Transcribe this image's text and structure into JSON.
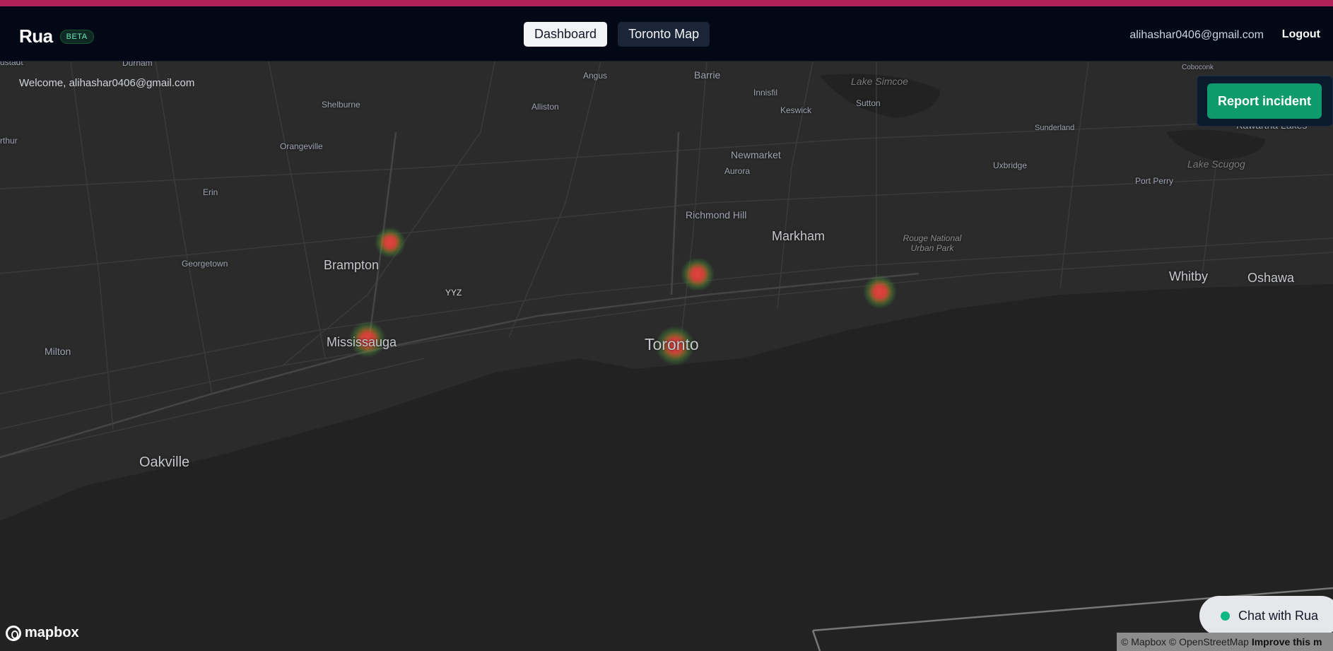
{
  "header": {
    "brand": "Rua",
    "badge": "BETA",
    "nav": [
      {
        "label": "Dashboard",
        "active": true
      },
      {
        "label": "Toronto Map",
        "active": false
      }
    ],
    "user_email": "alihashar0406@gmail.com",
    "logout_label": "Logout"
  },
  "map": {
    "welcome": "Welcome, alihashar0406@gmail.com",
    "report_button": "Report incident",
    "chat_button": "Chat with Rua",
    "logo_text": "mapbox",
    "attribution": {
      "text": "© Mapbox © OpenStreetMap",
      "link": "Improve this m"
    },
    "places": {
      "durham": "Durham",
      "ustadt": "ustadt",
      "arthur": "rthur",
      "angus": "Angus",
      "barrie": "Barrie",
      "innisfil": "Innisfil",
      "lake_simcoe": "Lake Simcoe",
      "keswick": "Keswick",
      "sutton": "Sutton",
      "shelburne": "Shelburne",
      "alliston": "Alliston",
      "coboconk": "Coboconk",
      "kawartha": "Kawartha Lakes",
      "sunderland": "Sunderland",
      "orangeville": "Orangeville",
      "newmarket": "Newmarket",
      "aurora": "Aurora",
      "uxbridge": "Uxbridge",
      "lake_scugog": "Lake Scugog",
      "port_perry": "Port Perry",
      "erin": "Erin",
      "richmond_hill": "Richmond Hill",
      "markham": "Markham",
      "rouge_park": "Rouge National Urban Park",
      "georgetown": "Georgetown",
      "brampton": "Brampton",
      "yyz": "YYZ",
      "whitby": "Whitby",
      "oshawa": "Oshawa",
      "milton": "Milton",
      "mississauga": "Mississauga",
      "toronto": "Toronto",
      "oakville": "Oakville"
    },
    "colors": {
      "hotspot_core": "#e0443a",
      "hotspot_glow": "#4caf3a",
      "accent": "#0e9a6a",
      "top_strip": "#b3205a"
    }
  }
}
